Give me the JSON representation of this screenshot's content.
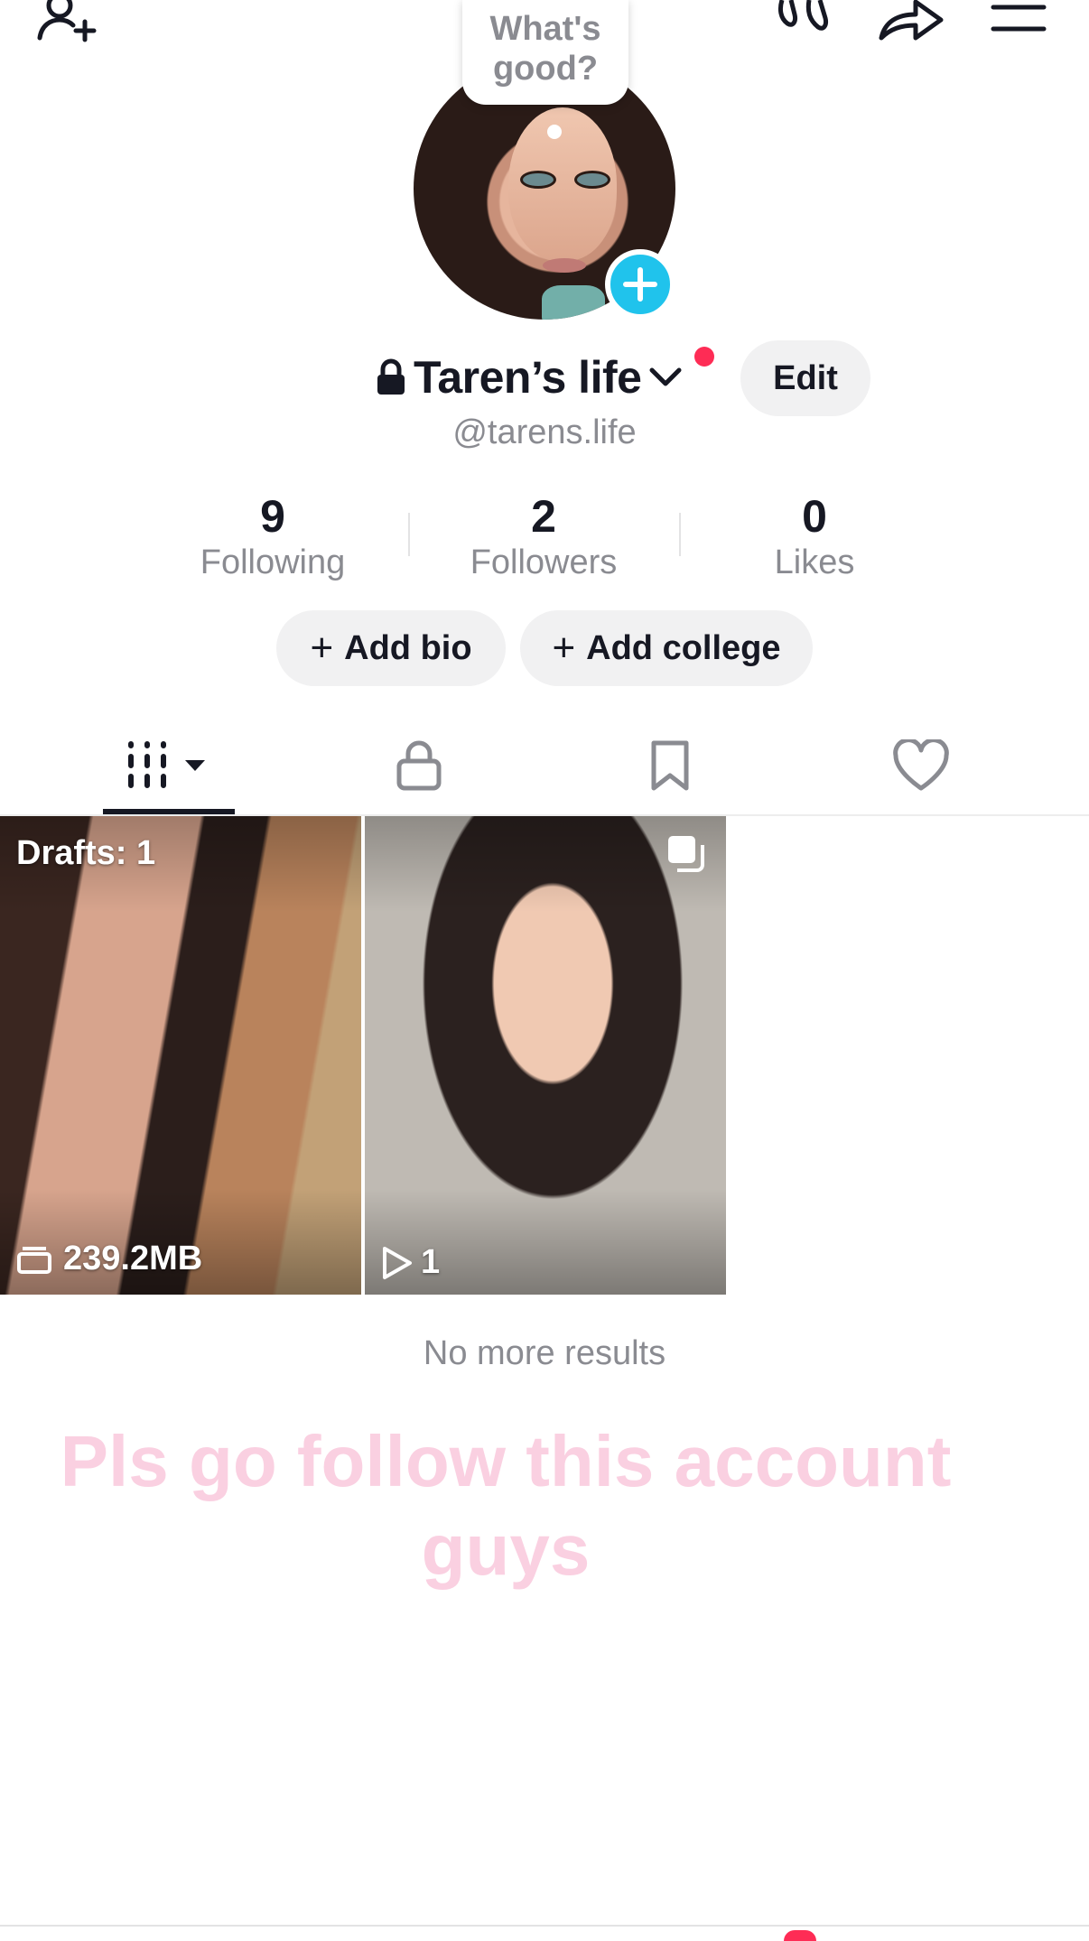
{
  "bubble": {
    "line1": "What's",
    "line2": "good?"
  },
  "profile": {
    "display_name": "Taren’s life",
    "handle": "@tarens.life",
    "edit_label": "Edit"
  },
  "stats": [
    {
      "value": "9",
      "label": "Following"
    },
    {
      "value": "2",
      "label": "Followers"
    },
    {
      "value": "0",
      "label": "Likes"
    }
  ],
  "actions": {
    "add_bio": "Add bio",
    "add_college": "Add college"
  },
  "tabs": [
    "videos",
    "private",
    "saved",
    "liked"
  ],
  "grid": {
    "drafts_label": "Drafts: 1",
    "drafts_size": "239.2MB",
    "video_views": "1"
  },
  "footer": {
    "no_more": "No more results"
  },
  "overlay": {
    "caption": "Pls go follow this account guys"
  },
  "colors": {
    "accent": "#fe2c55",
    "add_badge": "#20c3ec",
    "overlay_text": "#f5aac8"
  }
}
